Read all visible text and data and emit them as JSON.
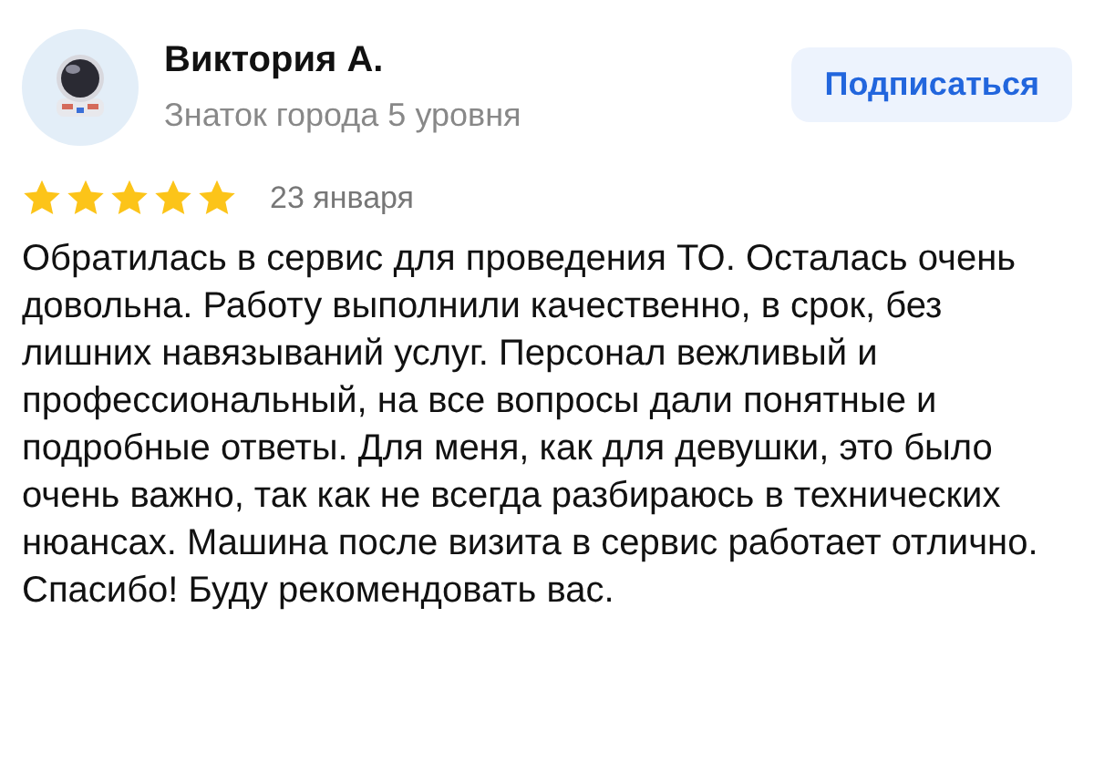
{
  "author": {
    "name": "Виктория А.",
    "level": "Знаток города 5 уровня"
  },
  "subscribe_button": "Подписаться",
  "review": {
    "stars": 5,
    "date": "23 января",
    "text": "Обратилась в сервис для проведения ТО. Осталась очень довольна. Работу выполнили качественно, в срок, без лишних навязываний услуг. Персонал вежливый и профессиональный, на все вопросы дали понятные и подробные ответы. Для меня, как для девушки, это было очень важно, так как не всегда разбираюсь в технических нюансах. Машина после визита в сервис работает отлично. Спасибо! Буду рекомендовать вас."
  }
}
